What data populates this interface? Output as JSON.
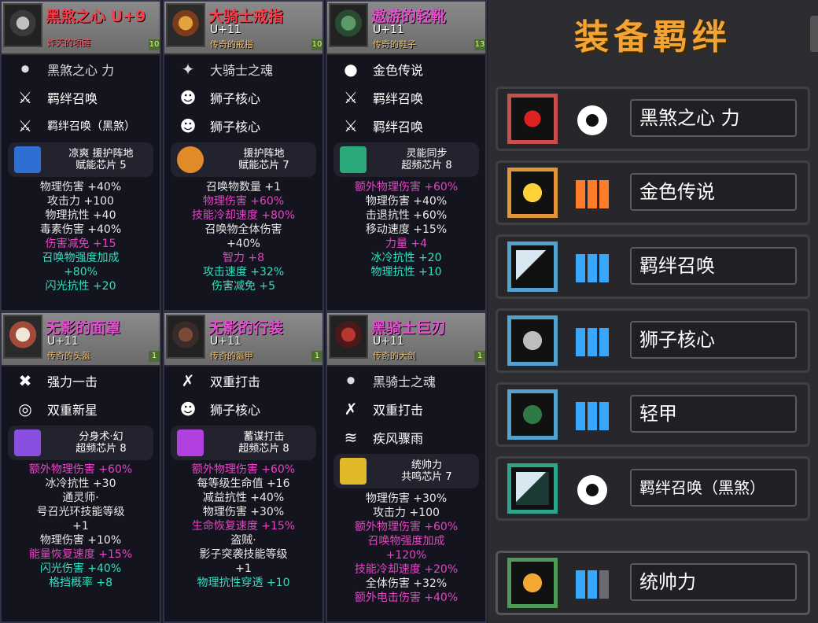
{
  "cards": [
    {
      "name": "黑煞之心 U+9",
      "level": "",
      "subtitle": "炸天的项链",
      "badge": "10",
      "skills": [
        "黑煞之心 力",
        "羁绊召唤",
        "羁绊召唤（黑煞）"
      ],
      "chip": "凉爽 援护阵地\n赋能芯片 5",
      "stats": [
        {
          "text": "物理伤害 +40%",
          "color": "white"
        },
        {
          "text": "攻击力 +100",
          "color": "white"
        },
        {
          "text": "物理抗性 +40",
          "color": "white"
        },
        {
          "text": "毒素伤害 +40%",
          "color": "white"
        },
        {
          "text": "伤害减免 +15",
          "color": "pink"
        },
        {
          "text": "召唤物强度加成",
          "color": "cyan"
        },
        {
          "text": "+80%",
          "color": "cyan"
        },
        {
          "text": "闪光抗性 +20",
          "color": "cyan"
        }
      ]
    },
    {
      "name": "大骑士戒指",
      "level": "U+11",
      "subtitle": "传奇的戒指",
      "badge": "10",
      "skills": [
        "大骑士之魂",
        "狮子核心",
        "狮子核心"
      ],
      "chip": "援护阵地\n赋能芯片 7",
      "stats": [
        {
          "text": "召唤物数量 +1",
          "color": "white"
        },
        {
          "text": "物理伤害 +60%",
          "color": "pink"
        },
        {
          "text": "技能冷却速度 +80%",
          "color": "pink"
        },
        {
          "text": "召唤物全体伤害",
          "color": "white"
        },
        {
          "text": "+40%",
          "color": "white"
        },
        {
          "text": "智力 +8",
          "color": "pink"
        },
        {
          "text": "攻击速度 +32%",
          "color": "cyan"
        },
        {
          "text": "伤害减免 +5",
          "color": "cyan"
        }
      ]
    },
    {
      "name": "遨游的轻靴",
      "level": "U+11",
      "subtitle": "传奇的鞋子",
      "badge": "13",
      "skills": [
        "金色传说",
        "羁绊召唤",
        "羁绊召唤"
      ],
      "chip": "灵能同步\n超频芯片 8",
      "stats": [
        {
          "text": "额外物理伤害 +60%",
          "color": "pink"
        },
        {
          "text": "物理伤害 +40%",
          "color": "white"
        },
        {
          "text": "击退抗性 +60%",
          "color": "white"
        },
        {
          "text": "移动速度 +15%",
          "color": "white"
        },
        {
          "text": "力量 +4",
          "color": "pink"
        },
        {
          "text": "冰冷抗性 +20",
          "color": "cyan"
        },
        {
          "text": "物理抗性 +10",
          "color": "cyan"
        }
      ]
    },
    {
      "name": "无影的面罩",
      "level": "U+11",
      "subtitle": "传奇的头盔",
      "badge": "1",
      "skills": [
        "强力一击",
        "双重新星"
      ],
      "chip": "分身术·幻\n超频芯片 8",
      "stats": [
        {
          "text": "额外物理伤害 +60%",
          "color": "pink"
        },
        {
          "text": "冰冷抗性 +30",
          "color": "white"
        },
        {
          "text": "通灵师·",
          "color": "white"
        },
        {
          "text": "号召光环技能等级",
          "color": "white"
        },
        {
          "text": "+1",
          "color": "white"
        },
        {
          "text": "物理伤害 +10%",
          "color": "white"
        },
        {
          "text": "能量恢复速度 +15%",
          "color": "pink"
        },
        {
          "text": "闪光伤害 +40%",
          "color": "cyan"
        },
        {
          "text": "格挡概率 +8",
          "color": "cyan"
        }
      ]
    },
    {
      "name": "无影的行装",
      "level": "U+11",
      "subtitle": "传奇的盔甲",
      "badge": "1",
      "skills": [
        "双重打击",
        "狮子核心"
      ],
      "chip": "蓄谋打击\n超频芯片 8",
      "stats": [
        {
          "text": "额外物理伤害 +60%",
          "color": "pink"
        },
        {
          "text": "每等级生命值 +16",
          "color": "white"
        },
        {
          "text": "减益抗性 +40%",
          "color": "white"
        },
        {
          "text": "物理伤害 +30%",
          "color": "white"
        },
        {
          "text": "生命恢复速度 +15%",
          "color": "pink"
        },
        {
          "text": "盗贼·",
          "color": "white"
        },
        {
          "text": "影子突袭技能等级",
          "color": "white"
        },
        {
          "text": "+1",
          "color": "white"
        },
        {
          "text": "物理抗性穿透 +10",
          "color": "cyan"
        }
      ]
    },
    {
      "name": "黑骑士巨刃",
      "level": "U+11",
      "subtitle": "传奇的大剑",
      "badge": "1",
      "skills": [
        "黑骑士之魂",
        "双重打击",
        "疾风骤雨"
      ],
      "chip": "统帅力\n共鸣芯片 7",
      "stats": [
        {
          "text": "物理伤害 +30%",
          "color": "white"
        },
        {
          "text": "攻击力 +100",
          "color": "white"
        },
        {
          "text": "额外物理伤害 +60%",
          "color": "pink"
        },
        {
          "text": "召唤物强度加成",
          "color": "pink"
        },
        {
          "text": "+120%",
          "color": "pink"
        },
        {
          "text": "技能冷却速度 +20%",
          "color": "pink"
        },
        {
          "text": "全体伤害 +32%",
          "color": "white"
        },
        {
          "text": "额外电击伤害 +40%",
          "color": "pink"
        }
      ]
    }
  ],
  "panel": {
    "title": "装备羁绊",
    "bonds": [
      {
        "label": "黑煞之心 力",
        "icon_border": "red",
        "indicator": "eye"
      },
      {
        "label": "金色传说",
        "icon_border": "gold",
        "indicator": "bars-orange"
      },
      {
        "label": "羁绊召唤",
        "icon_border": "blue",
        "indicator": "bars-blue"
      },
      {
        "label": "狮子核心",
        "icon_border": "blue",
        "indicator": "bars-blue"
      },
      {
        "label": "轻甲",
        "icon_border": "blue",
        "indicator": "bars-blue"
      },
      {
        "label": "羁绊召唤（黑煞）",
        "icon_border": "teal",
        "indicator": "eye"
      },
      {
        "label": "统帅力",
        "icon_border": "green",
        "indicator": "bars-blue-2"
      }
    ]
  }
}
